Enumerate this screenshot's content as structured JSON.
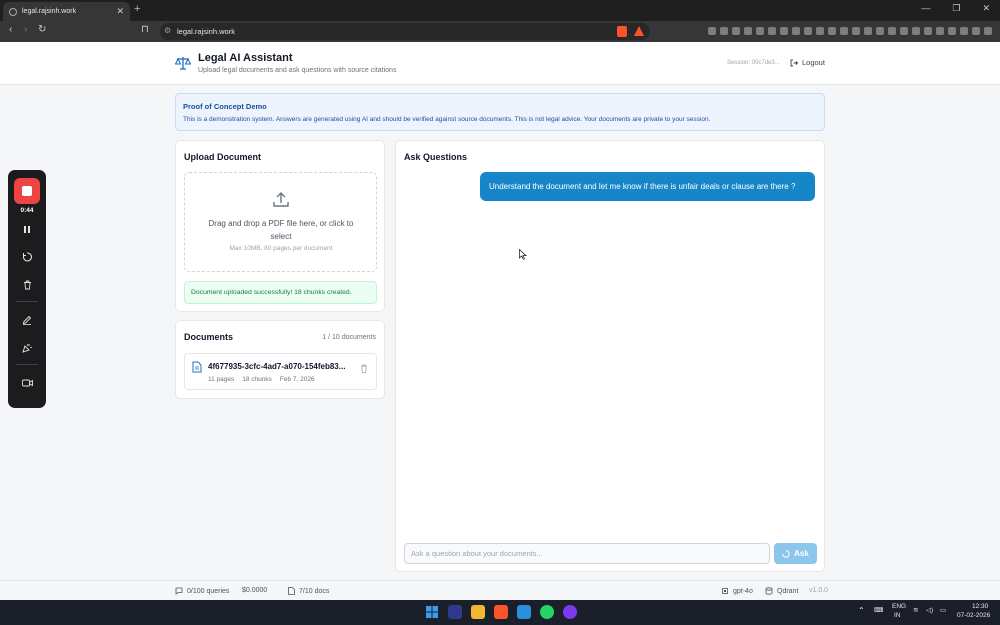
{
  "browser": {
    "tab_title": "legal.rajsinh.work",
    "new_tab": "+",
    "tab_close": "✕",
    "url": "legal.rajsinh.work",
    "window_controls": [
      "—",
      "❐",
      "✕"
    ]
  },
  "header": {
    "title": "Legal AI Assistant",
    "subtitle": "Upload legal documents and ask questions with source citations",
    "session": "Session: 00c7de3...",
    "logout_label": "Logout"
  },
  "banner": {
    "title": "Proof of Concept Demo",
    "text": "This is a demonstration system. Answers are generated using AI and should be verified against source documents. This is not legal advice. Your documents are private to your session."
  },
  "upload": {
    "title": "Upload Document",
    "drop_text": "Drag and drop a PDF file here, or click to select",
    "hint": "Max 10MB, 80 pages per document",
    "success": "Document uploaded successfully! 18 chunks created."
  },
  "documents": {
    "title": "Documents",
    "count": "1 / 10 documents",
    "items": [
      {
        "name": "4f677935-3cfc-4ad7-a070-154feb83...",
        "pages": "11 pages",
        "chunks": "18 chunks",
        "date": "Feb 7, 2026"
      }
    ]
  },
  "ask": {
    "title": "Ask Questions",
    "messages": [
      {
        "role": "user",
        "text": "Understand the document and let me know if there is unfair deals or clause are there ?"
      }
    ],
    "input_placeholder": "Ask a question about your documents...",
    "button_label": "Ask"
  },
  "recorder": {
    "time": "0:44"
  },
  "footer": {
    "queries": "0/100 queries",
    "cost": "$0.0000",
    "docs": "7/10 docs",
    "model": "gpt-4o",
    "vector_db": "Qdrant",
    "version": "v1.0.0"
  },
  "taskbar": {
    "lang": "ENG",
    "region": "IN",
    "time": "12:30",
    "date": "07-02-2026"
  },
  "colors": {
    "accent": "#1786c9",
    "ask_button": "#8cc6ea",
    "record": "#ef4444",
    "success_text": "#15803d",
    "banner_bg": "#eef4fd"
  }
}
